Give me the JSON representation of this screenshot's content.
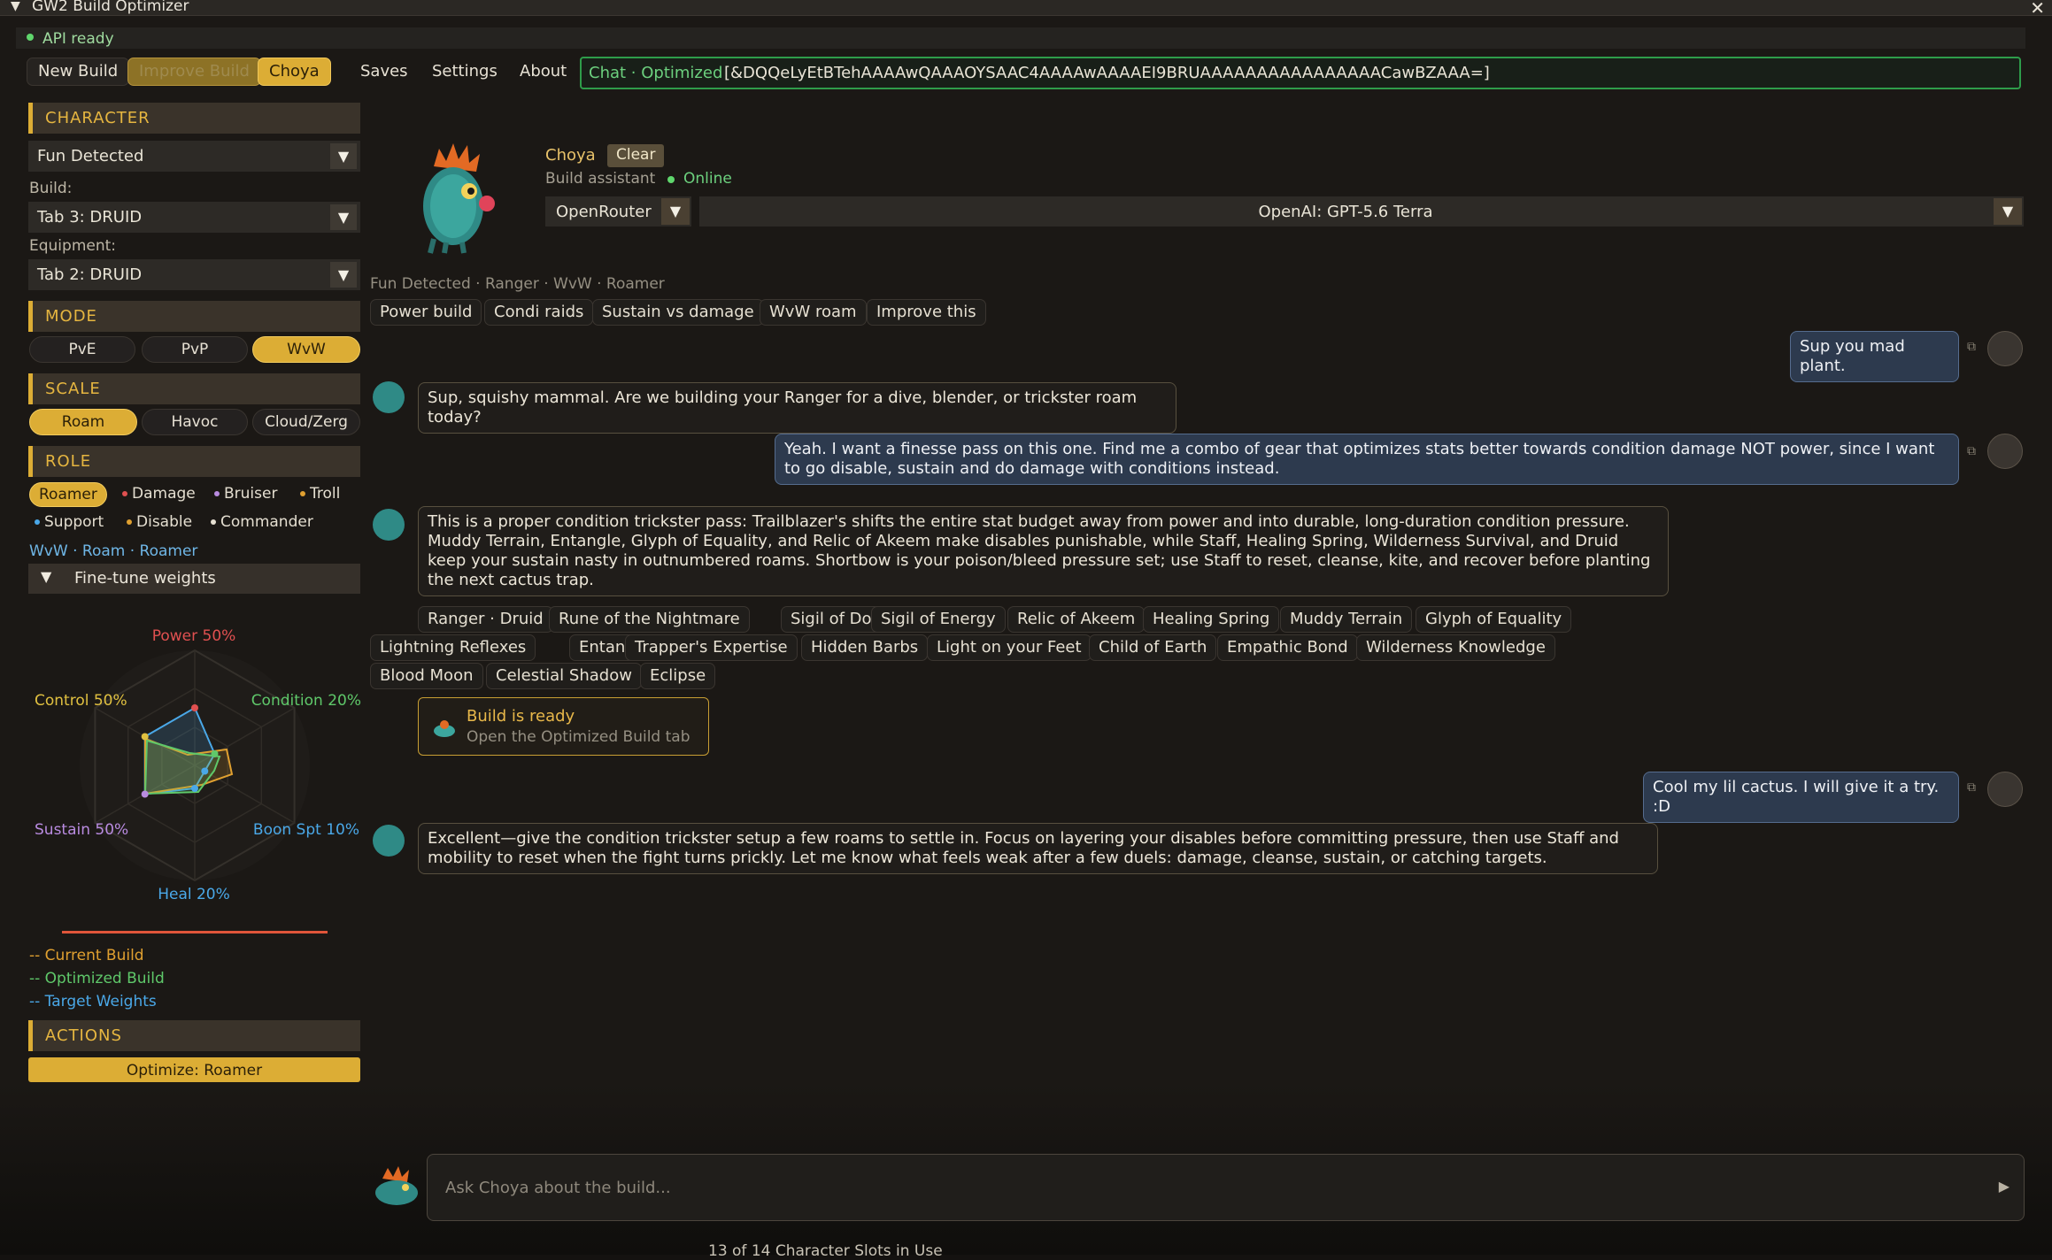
{
  "window": {
    "title": "GW2 Build Optimizer"
  },
  "status": {
    "text": "API ready"
  },
  "nav": {
    "new_build": "New Build",
    "improve_build": "Improve Build",
    "choya": "Choya",
    "saves": "Saves",
    "settings": "Settings",
    "about": "About"
  },
  "chatbar": {
    "label": "Chat · Optimized",
    "code": "[&DQQeLyEtBTehAAAAwQAAAOYSAAC4AAAAwAAAAEI9BRUAAAAAAAAAAAAAAAACawBZAAA=]"
  },
  "character": {
    "header": "CHARACTER",
    "name": "Fun Detected",
    "build_label": "Build:",
    "build": "Tab 3: DRUID",
    "equipment_label": "Equipment:",
    "equipment": "Tab 2: DRUID"
  },
  "mode": {
    "header": "MODE",
    "options": [
      "PvE",
      "PvP",
      "WvW"
    ],
    "selected": "WvW"
  },
  "scale": {
    "header": "SCALE",
    "options": [
      "Roam",
      "Havoc",
      "Cloud/Zerg"
    ],
    "selected": "Roam"
  },
  "role": {
    "header": "ROLE",
    "options": [
      "Roamer",
      "Damage",
      "Bruiser",
      "Troll",
      "Support",
      "Disable",
      "Commander"
    ],
    "selected": "Roamer",
    "summary": "WvW · Roam · Roamer"
  },
  "finetune": {
    "label": "Fine-tune weights"
  },
  "radar": {
    "labels": [
      "Power 50%",
      "Condition 20%",
      "Boon Spt 10%",
      "Heal 20%",
      "Sustain 50%",
      "Control 50%"
    ]
  },
  "legend": {
    "current": "-- Current Build",
    "optimized": "-- Optimized Build",
    "target": "-- Target Weights"
  },
  "actions": {
    "header": "ACTIONS",
    "optimize": "Optimize: Roamer"
  },
  "assistant": {
    "name": "Choya",
    "clear": "Clear",
    "subtitle": "Build assistant",
    "status": "Online",
    "provider": "OpenRouter",
    "model": "OpenAI: GPT-5.6 Terra"
  },
  "context": "Fun Detected · Ranger · WvW · Roamer",
  "quick": [
    "Power build",
    "Condi raids",
    "Sustain vs damage",
    "WvW roam",
    "Improve this"
  ],
  "messages": {
    "u1": "Sup you mad plant.",
    "a1": "Sup, squishy mammal. Are we building your Ranger for a dive, blender, or trickster roam today?",
    "u2": "Yeah. I want a finesse pass on this one. Find me a combo of gear that optimizes stats better towards condition damage NOT power, since I want to go disable, sustain and do damage with conditions instead.",
    "a2": "This is a proper condition trickster pass: Trailblazer's shifts the entire stat budget away from power and into durable, long-duration condition pressure. Muddy Terrain, Entangle, Glyph of Equality, and Relic of Akeem make disables punishable, while Staff, Healing Spring, Wilderness Survival, and Druid keep your sustain nasty in outnumbered roams. Shortbow is your poison/bleed pressure set; use Staff to reset, cleanse, kite, and recover before planting the next cactus trap.",
    "u3": "Cool my lil cactus. I will give it a try. :D",
    "a3": "Excellent—give the condition trickster setup a few roams to settle in. Focus on layering your disables before committing pressure, then use Staff and mobility to reset when the fight turns prickly. Let me know what feels weak after a few duels: damage, cleanse, sustain, or catching targets."
  },
  "tags": [
    "Ranger · Druid",
    "Rune of the Nightmare",
    "Sigil of Doom",
    "Sigil of Energy",
    "Relic of Akeem",
    "Healing Spring",
    "Muddy Terrain",
    "Glyph of Equality",
    "Lightning Reflexes",
    "Entangle",
    "Trapper's Expertise",
    "Hidden Barbs",
    "Light on your Feet",
    "Child of Earth",
    "Empathic Bond",
    "Wilderness Knowledge",
    "Blood Moon",
    "Celestial Shadow",
    "Eclipse"
  ],
  "ready": {
    "title": "Build is ready",
    "subtitle": "Open the Optimized Build tab"
  },
  "input": {
    "placeholder": "Ask Choya about the build..."
  },
  "footer": "13 of 14 Character Slots in Use",
  "colors": {
    "accent": "#dcad35",
    "online": "#5fd66c",
    "user_bubble": "#2d3a4e",
    "current_build": "#e0a030",
    "optimized_build": "#5fc86a",
    "target_weights": "#4aa8e8"
  }
}
